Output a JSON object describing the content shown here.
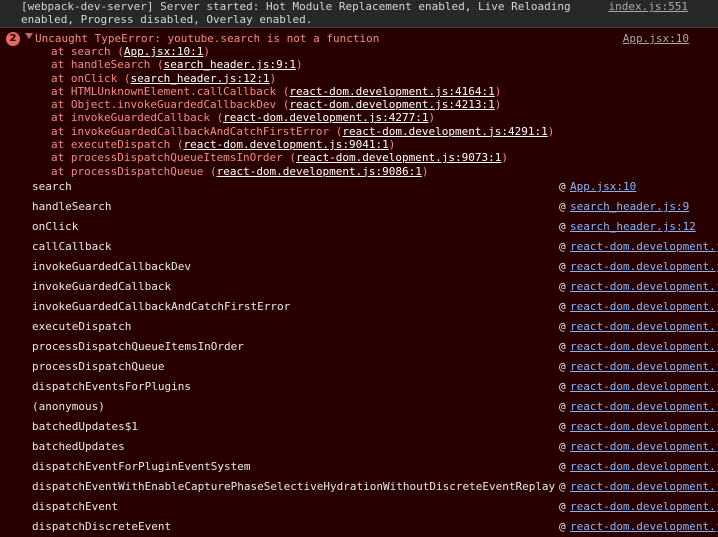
{
  "info": {
    "text": "[webpack-dev-server] Server started: Hot Module Replacement enabled, Live Reloading\nenabled, Progress disabled, Overlay enabled.",
    "source": "index.js:551"
  },
  "error": {
    "count": "2",
    "message": "Uncaught TypeError: youtube.search is not a function",
    "source": "App.jsx:10",
    "trace": [
      {
        "pre": "at search (",
        "loc": "App.jsx:10:1",
        "post": ")"
      },
      {
        "pre": "at handleSearch (",
        "loc": "search_header.js:9:1",
        "post": ")"
      },
      {
        "pre": "at onClick (",
        "loc": "search_header.js:12:1",
        "post": ")"
      },
      {
        "pre": "at HTMLUnknownElement.callCallback (",
        "loc": "react-dom.development.js:4164:1",
        "post": ")"
      },
      {
        "pre": "at Object.invokeGuardedCallbackDev (",
        "loc": "react-dom.development.js:4213:1",
        "post": ")"
      },
      {
        "pre": "at invokeGuardedCallback (",
        "loc": "react-dom.development.js:4277:1",
        "post": ")"
      },
      {
        "pre": "at invokeGuardedCallbackAndCatchFirstError (",
        "loc": "react-dom.development.js:4291:1",
        "post": ")"
      },
      {
        "pre": "at executeDispatch (",
        "loc": "react-dom.development.js:9041:1",
        "post": ")"
      },
      {
        "pre": "at processDispatchQueueItemsInOrder (",
        "loc": "react-dom.development.js:9073:1",
        "post": ")"
      },
      {
        "pre": "at processDispatchQueue (",
        "loc": "react-dom.development.js:9086:1",
        "post": ")"
      }
    ],
    "frames": [
      {
        "fn": "search",
        "loc": "App.jsx:10"
      },
      {
        "fn": "handleSearch",
        "loc": "search_header.js:9"
      },
      {
        "fn": "onClick",
        "loc": "search_header.js:12"
      },
      {
        "fn": "callCallback",
        "loc": "react-dom.development.js"
      },
      {
        "fn": "invokeGuardedCallbackDev",
        "loc": "react-dom.development.js"
      },
      {
        "fn": "invokeGuardedCallback",
        "loc": "react-dom.development.js"
      },
      {
        "fn": "invokeGuardedCallbackAndCatchFirstError",
        "loc": "react-dom.development.js"
      },
      {
        "fn": "executeDispatch",
        "loc": "react-dom.development.js"
      },
      {
        "fn": "processDispatchQueueItemsInOrder",
        "loc": "react-dom.development.js"
      },
      {
        "fn": "processDispatchQueue",
        "loc": "react-dom.development.js"
      },
      {
        "fn": "dispatchEventsForPlugins",
        "loc": "react-dom.development.js"
      },
      {
        "fn": "(anonymous)",
        "loc": "react-dom.development.js"
      },
      {
        "fn": "batchedUpdates$1",
        "loc": "react-dom.development.js"
      },
      {
        "fn": "batchedUpdates",
        "loc": "react-dom.development.js"
      },
      {
        "fn": "dispatchEventForPluginEventSystem",
        "loc": "react-dom.development.js"
      },
      {
        "fn": "dispatchEventWithEnableCapturePhaseSelectiveHydrationWithoutDiscreteEventReplay",
        "loc": "react-dom.development.js"
      },
      {
        "fn": "dispatchEvent",
        "loc": "react-dom.development.js"
      },
      {
        "fn": "dispatchDiscreteEvent",
        "loc": "react-dom.development.js"
      }
    ],
    "at_symbol": "@"
  },
  "colors": {
    "background": "#282828",
    "error_background": "#290000",
    "error_text": "#f28b82",
    "link": "#8ab4f8",
    "badge": "#e46962"
  },
  "icons": {
    "expand": "triangle-down-icon"
  }
}
